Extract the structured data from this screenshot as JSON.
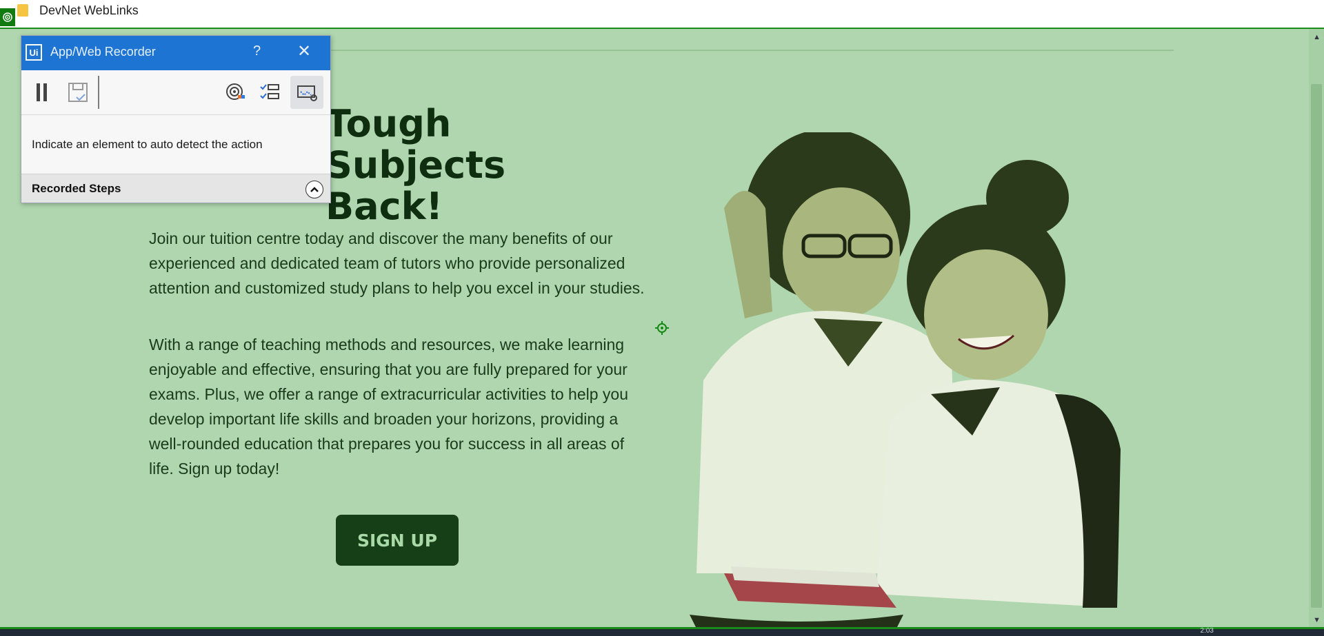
{
  "window": {
    "title": "DevNet WebLinks"
  },
  "hero": {
    "headline_line1": "Tough Subjects",
    "headline_line2": "Back!",
    "paragraph1": "Join our tuition centre today and discover the many benefits of our experienced and dedicated team of tutors who provide personalized attention and customized study plans to help you excel in your studies.",
    "paragraph2": "With a range of teaching methods and resources, we make learning enjoyable and effective, ensuring that you are fully prepared for your exams. Plus, we offer a range of extracurricular activities to help you develop important life skills and broaden your horizons, providing a well-rounded education that prepares you for success in all areas of life. Sign up today!",
    "cta_label": "SIGN UP"
  },
  "recorder": {
    "logo": "Ui",
    "title": "App/Web Recorder",
    "help": "?",
    "close": "✕",
    "message": "Indicate an element to auto detect the action",
    "steps_label": "Recorded Steps",
    "tools": [
      "pause-icon",
      "save-icon",
      "target-icon",
      "checklist-icon",
      "screen-scrape-icon"
    ]
  },
  "taskbar": {
    "clock": "2:03"
  },
  "colors": {
    "page_bg": "#afd6ae",
    "accent": "#163f17",
    "recorder_header": "#1d74d3"
  }
}
